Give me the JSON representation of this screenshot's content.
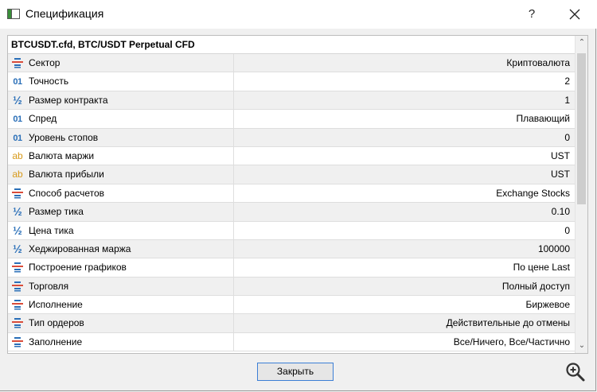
{
  "window": {
    "title": "Спецификация",
    "help_label": "?"
  },
  "panel": {
    "header": "BTCUSDT.cfd, BTC/USDT Perpetual CFD"
  },
  "rows": [
    {
      "icon": "list-icon",
      "name": "Сектор",
      "value": "Криптовалюта"
    },
    {
      "icon": "number-icon",
      "name": "Точность",
      "value": "2"
    },
    {
      "icon": "fraction-icon",
      "name": "Размер контракта",
      "value": "1"
    },
    {
      "icon": "number-icon",
      "name": "Спред",
      "value": "Плавающий"
    },
    {
      "icon": "number-icon",
      "name": "Уровень стопов",
      "value": "0"
    },
    {
      "icon": "text-icon",
      "name": "Валюта маржи",
      "value": "UST"
    },
    {
      "icon": "text-icon",
      "name": "Валюта прибыли",
      "value": "UST"
    },
    {
      "icon": "list-icon",
      "name": "Способ расчетов",
      "value": "Exchange Stocks"
    },
    {
      "icon": "fraction-icon",
      "name": "Размер тика",
      "value": "0.10"
    },
    {
      "icon": "fraction-icon",
      "name": "Цена тика",
      "value": "0"
    },
    {
      "icon": "fraction-icon",
      "name": "Хеджированная маржа",
      "value": "100000"
    },
    {
      "icon": "list-icon",
      "name": "Построение графиков",
      "value": "По цене Last"
    },
    {
      "icon": "list-icon",
      "name": "Торговля",
      "value": "Полный доступ"
    },
    {
      "icon": "list-icon",
      "name": "Исполнение",
      "value": "Биржевое"
    },
    {
      "icon": "list-icon",
      "name": "Тип ордеров",
      "value": "Действительные до отмены"
    },
    {
      "icon": "list-icon",
      "name": "Заполнение",
      "value": "Все/Ничего, Все/Частично"
    }
  ],
  "footer": {
    "close_label": "Закрыть"
  }
}
